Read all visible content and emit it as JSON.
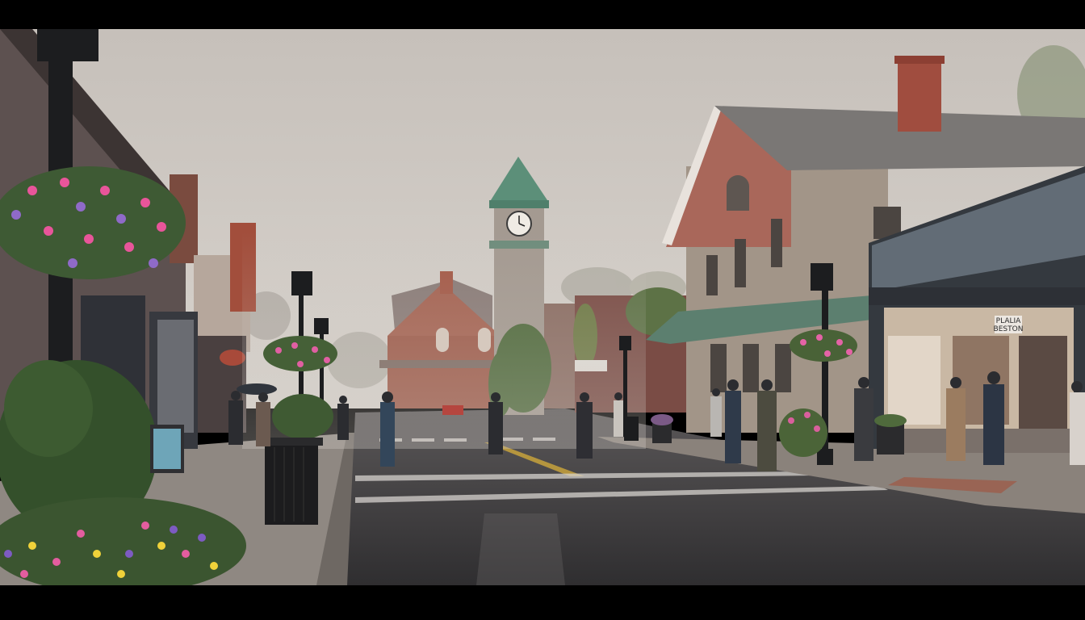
{
  "scene": {
    "type": "photograph",
    "letterbox_color": "#000000",
    "palette": {
      "sky": "#c9c3bc",
      "road": "#3a3a3c",
      "sidewalk": "#8e8680",
      "brick": "#9c5a4a",
      "stone": "#9a8f86",
      "roof_green": "#5d8f7c",
      "foliage": "#3f5a36"
    },
    "sign_shop": "PLALIA\nBESTON"
  }
}
